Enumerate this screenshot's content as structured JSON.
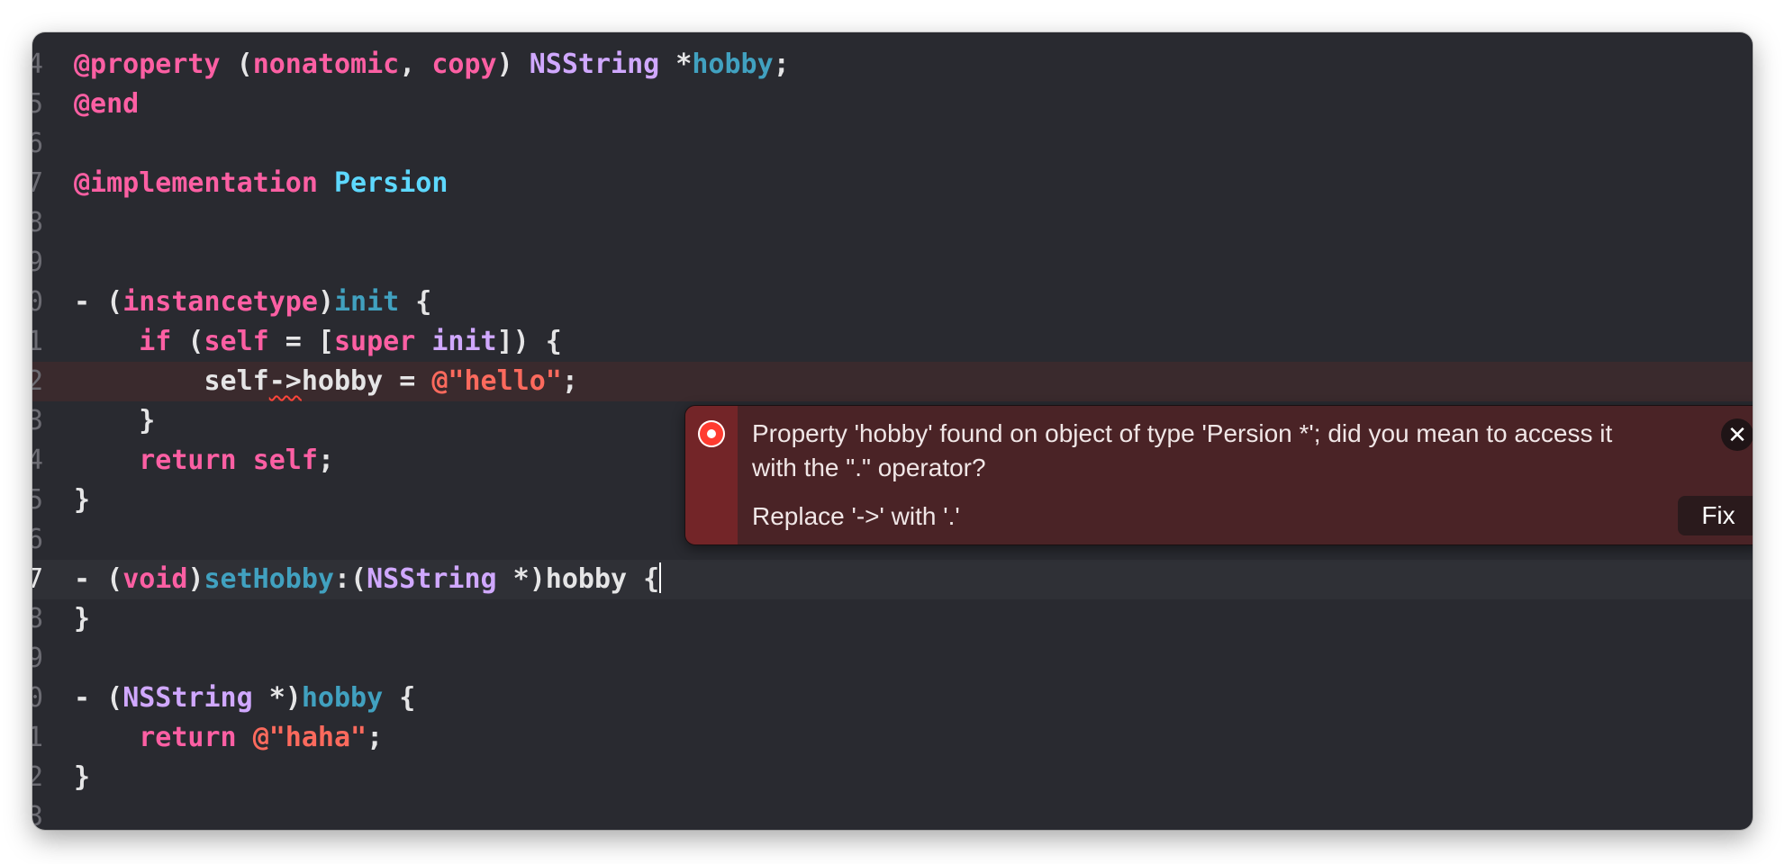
{
  "editor": {
    "lines": [
      {
        "n": "4",
        "t": [
          [
            "kw",
            "@property"
          ],
          [
            "plain",
            " ("
          ],
          [
            "kw",
            "nonatomic"
          ],
          [
            "plain",
            ", "
          ],
          [
            "kw",
            "copy"
          ],
          [
            "plain",
            ") "
          ],
          [
            "type",
            "NSString"
          ],
          [
            "plain",
            " *"
          ],
          [
            "ident",
            "hobby"
          ],
          [
            "plain",
            ";"
          ]
        ]
      },
      {
        "n": "5",
        "t": [
          [
            "kw",
            "@end"
          ]
        ]
      },
      {
        "n": "6",
        "t": []
      },
      {
        "n": "7",
        "t": [
          [
            "kw",
            "@implementation"
          ],
          [
            "plain",
            " "
          ],
          [
            "method",
            "Persion"
          ]
        ]
      },
      {
        "n": "8",
        "t": []
      },
      {
        "n": "9",
        "t": []
      },
      {
        "n": "0",
        "t": [
          [
            "plain",
            "- ("
          ],
          [
            "kw",
            "instancetype"
          ],
          [
            "plain",
            ")"
          ],
          [
            "ident",
            "init"
          ],
          [
            "plain",
            " {"
          ]
        ]
      },
      {
        "n": "1",
        "t": [
          [
            "plain",
            "    "
          ],
          [
            "kw",
            "if"
          ],
          [
            "plain",
            " ("
          ],
          [
            "kw",
            "self"
          ],
          [
            "plain",
            " = ["
          ],
          [
            "kw",
            "super"
          ],
          [
            "plain",
            " "
          ],
          [
            "type",
            "init"
          ],
          [
            "plain",
            "]) {"
          ]
        ]
      },
      {
        "n": "2",
        "t": [
          [
            "plain",
            "        self"
          ],
          [
            "err",
            "->"
          ],
          [
            "plain",
            "hobby = "
          ],
          [
            "str",
            "@\"hello\""
          ],
          [
            "plain",
            ";"
          ]
        ],
        "error": true
      },
      {
        "n": "3",
        "t": [
          [
            "plain",
            "    }"
          ]
        ]
      },
      {
        "n": "4",
        "t": [
          [
            "plain",
            "    "
          ],
          [
            "kw",
            "return"
          ],
          [
            "plain",
            " "
          ],
          [
            "kw",
            "self"
          ],
          [
            "plain",
            ";"
          ]
        ]
      },
      {
        "n": "5",
        "t": [
          [
            "plain",
            "}"
          ]
        ]
      },
      {
        "n": "6",
        "t": []
      },
      {
        "n": "7",
        "t": [
          [
            "plain",
            "- ("
          ],
          [
            "kw",
            "void"
          ],
          [
            "plain",
            ")"
          ],
          [
            "ident",
            "setHobby"
          ],
          [
            "plain",
            ":("
          ],
          [
            "type",
            "NSString"
          ],
          [
            "plain",
            " *)hobby {"
          ],
          [
            "caret",
            ""
          ]
        ],
        "current": true
      },
      {
        "n": "8",
        "t": [
          [
            "plain",
            "}"
          ]
        ]
      },
      {
        "n": "9",
        "t": []
      },
      {
        "n": "0",
        "t": [
          [
            "plain",
            "- ("
          ],
          [
            "type",
            "NSString"
          ],
          [
            "plain",
            " *)"
          ],
          [
            "ident",
            "hobby"
          ],
          [
            "plain",
            " {"
          ]
        ]
      },
      {
        "n": "1",
        "t": [
          [
            "plain",
            "    "
          ],
          [
            "kw",
            "return"
          ],
          [
            "plain",
            " "
          ],
          [
            "str",
            "@\"haha\""
          ],
          [
            "plain",
            ";"
          ]
        ]
      },
      {
        "n": "2",
        "t": [
          [
            "plain",
            "}"
          ]
        ]
      },
      {
        "n": "3",
        "t": []
      }
    ]
  },
  "error_popover": {
    "icon": "error-icon",
    "message": "Property 'hobby' found on object of type 'Persion *'; did you mean to access it with the \".\" operator?",
    "fix_hint": "Replace '->' with '.'",
    "close_label": "✕",
    "fix_label": "Fix"
  },
  "colors": {
    "editor_background": "#292a30",
    "keyword": "#fc5fa3",
    "type": "#d0a8ff",
    "string": "#fc6a5d",
    "identifier": "#41a1c0",
    "error_accent": "#732528",
    "error_background": "#4a2326"
  }
}
